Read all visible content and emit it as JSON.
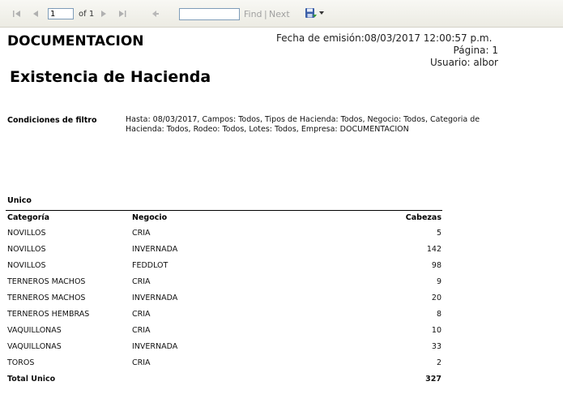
{
  "toolbar": {
    "page_value": "1",
    "of_label": "of 1",
    "find_label": "Find",
    "separator": "|",
    "next_label": "Next"
  },
  "report": {
    "company": "DOCUMENTACION",
    "emision": "Fecha de emisión:08/03/2017 12:00:57 p.m.",
    "pagina": "Página: 1",
    "usuario": "Usuario: albor",
    "title": "Existencia de Hacienda",
    "filter_label": "Condiciones de filtro",
    "filter_text": "Hasta: 08/03/2017, Campos: Todos, Tipos de Hacienda: Todos, Negocio: Todos, Categoria de Hacienda: Todos, Rodeo: Todos, Lotes: Todos, Empresa: DOCUMENTACION",
    "group_label": "Unico",
    "columns": [
      "Categoría",
      "Negocio",
      "Cabezas"
    ],
    "rows": [
      [
        "NOVILLOS",
        "CRIA",
        "5"
      ],
      [
        "NOVILLOS",
        "INVERNADA",
        "142"
      ],
      [
        "NOVILLOS",
        "FEDDLOT",
        "98"
      ],
      [
        "TERNEROS MACHOS",
        "CRIA",
        "9"
      ],
      [
        "TERNEROS MACHOS",
        "INVERNADA",
        "20"
      ],
      [
        "TERNEROS HEMBRAS",
        "CRIA",
        "8"
      ],
      [
        "VAQUILLONAS",
        "CRIA",
        "10"
      ],
      [
        "VAQUILLONAS",
        "INVERNADA",
        "33"
      ],
      [
        "TOROS",
        "CRIA",
        "2"
      ]
    ],
    "total_label": "Total Unico",
    "total_value": "327"
  }
}
